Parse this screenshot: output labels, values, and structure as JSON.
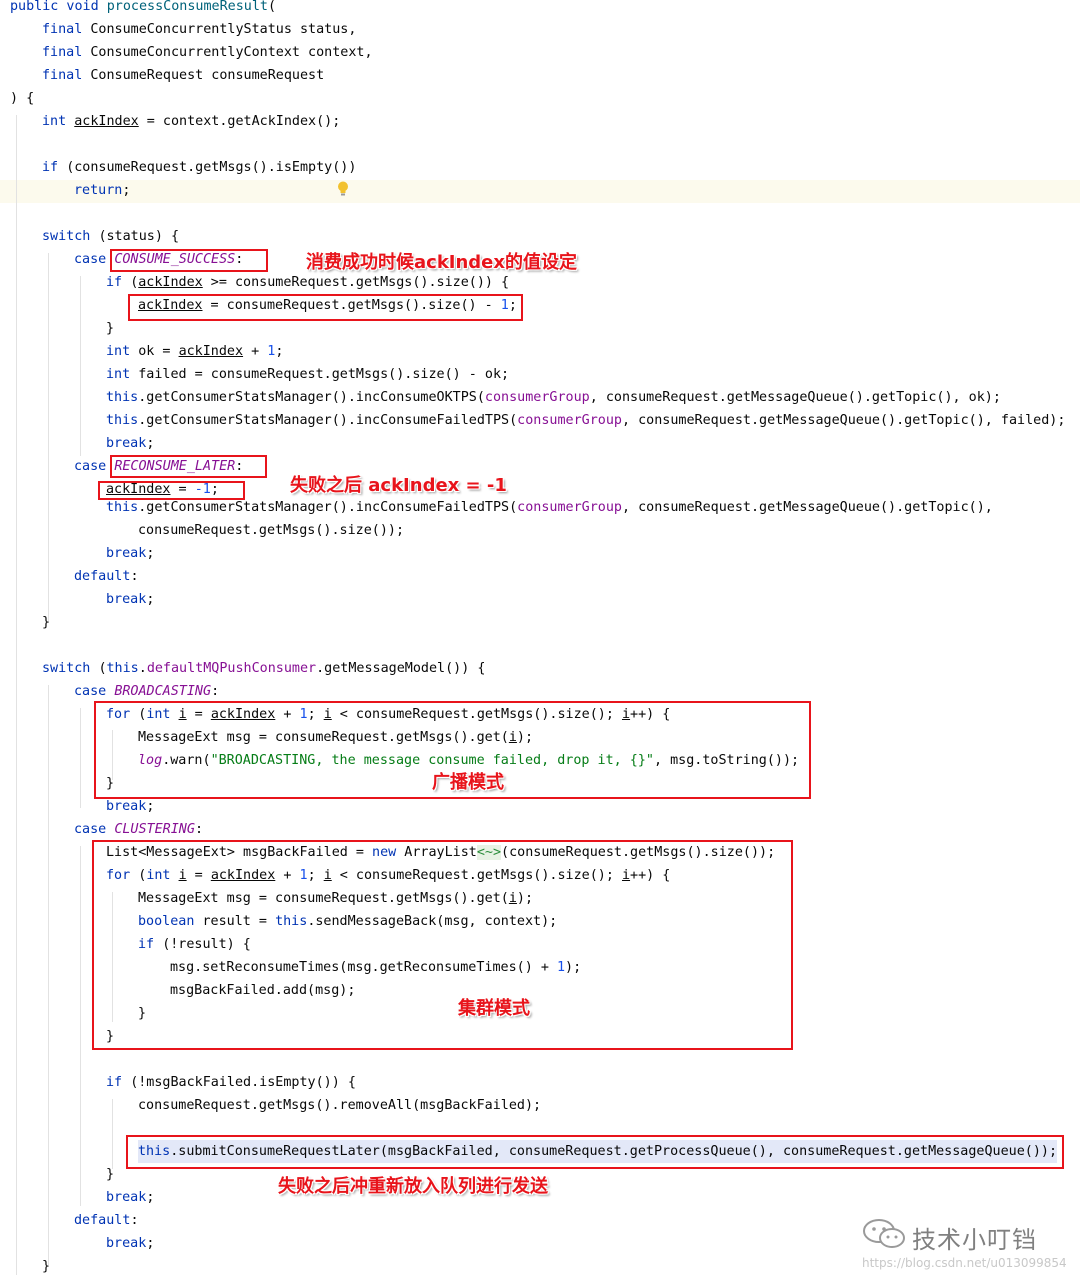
{
  "code": {
    "method_signature": [
      "public void ",
      "processConsumeResult",
      "("
    ],
    "param_status": [
      "final ",
      "ConsumeConcurrentlyStatus status,"
    ],
    "param_context": [
      "final ",
      "ConsumeConcurrentlyContext context,"
    ],
    "param_request": [
      "final ",
      "ConsumeRequest consumeRequest"
    ],
    "close_paren": ") {",
    "ack_decl": [
      "int ",
      "ackIndex",
      " = context.getAckIndex();"
    ],
    "if_empty": [
      "if ",
      "(consumeRequest.getMsgs().isEmpty())"
    ],
    "return_stmt": [
      "return",
      ";"
    ],
    "switch_status": [
      "switch ",
      "(status) {"
    ],
    "case_success": [
      "case ",
      "CONSUME_SUCCESS",
      ":"
    ],
    "if_ack": [
      "if ",
      "(",
      "ackIndex",
      " >= consumeRequest.getMsgs().size()) {"
    ],
    "ack_assign": [
      "ackIndex",
      " = consumeRequest.getMsgs().size() - ",
      "1",
      ";"
    ],
    "close_brace": "}",
    "int_ok": [
      "int ",
      "ok = ",
      "ackIndex",
      " + ",
      "1",
      ";"
    ],
    "int_failed": [
      "int ",
      "failed = consumeRequest.getMsgs().size() - ok;"
    ],
    "inc_ok": [
      "this",
      ".getConsumerStatsManager().incConsumeOKTPS(",
      "consumerGroup",
      ", consumeRequest.getMessageQueue().getTopic(), ok);"
    ],
    "inc_failed": [
      "this",
      ".getConsumerStatsManager().incConsumeFailedTPS(",
      "consumerGroup",
      ", consumeRequest.getMessageQueue().getTopic(), failed);"
    ],
    "break_stmt": [
      "break",
      ";"
    ],
    "case_later": [
      "case ",
      "RECONSUME_LATER",
      ":"
    ],
    "ack_minus": [
      "ackIndex",
      " = ",
      "-1",
      ";"
    ],
    "inc_failed2": [
      "this",
      ".getConsumerStatsManager().incConsumeFailedTPS(",
      "consumerGroup",
      ", consumeRequest.getMessageQueue().getTopic(),"
    ],
    "msgs_size": "consumeRequest.getMsgs().size());",
    "default_label": [
      "default",
      ":"
    ],
    "switch_model": [
      "switch ",
      "(",
      "this",
      ".",
      "defaultMQPushConsumer",
      ".getMessageModel()) {"
    ],
    "case_broadcasting": [
      "case ",
      "BROADCASTING",
      ":"
    ],
    "for_loop": [
      "for ",
      "(",
      "int ",
      "i",
      " = ",
      "ackIndex",
      " + ",
      "1",
      "; ",
      "i",
      " < consumeRequest.getMsgs().size(); ",
      "i",
      "++) {"
    ],
    "msg_ext": [
      "MessageExt msg = consumeRequest.getMsgs().get(",
      "i",
      ");"
    ],
    "log_warn": [
      "log",
      ".warn(",
      "\"BROADCASTING, the message consume failed, drop it, {}\"",
      ", msg.toString());"
    ],
    "case_clustering": [
      "case ",
      "CLUSTERING",
      ":"
    ],
    "list_decl": [
      "List<MessageExt> msgBackFailed = ",
      "new ",
      "ArrayList",
      "<~>",
      "(consumeRequest.getMsgs().size());"
    ],
    "boolean_result": [
      "boolean ",
      "result = ",
      "this",
      ".sendMessageBack(msg, context);"
    ],
    "if_not_result": [
      "if ",
      "(!result) {"
    ],
    "set_reconsume": [
      "msg.setReconsumeTimes(msg.getReconsumeTimes() + ",
      "1",
      ");"
    ],
    "add_failed": "msgBackFailed.add(msg);",
    "if_not_empty": [
      "if ",
      "(!msgBackFailed.isEmpty()) {"
    ],
    "remove_all": "consumeRequest.getMsgs().removeAll(msgBackFailed);",
    "submit_later": [
      "this",
      ".submitConsumeRequestLater(msgBackFailed, consumeRequest.getProcessQueue(), consumeRequest.getMessageQueue());"
    ]
  },
  "annotations": {
    "success_note": "消费成功时候ackIndex的值设定",
    "failure_note": "失败之后 ackIndex = -1",
    "broadcast_note": "广播模式",
    "cluster_note": "集群模式",
    "resend_note": "失败之后冲重新放入队列进行发送"
  },
  "watermark": {
    "icon": "wechat-icon",
    "account": "技术小叮铛",
    "url": "https://blog.csdn.net/u013099854"
  },
  "colors": {
    "keyword": "#0033b3",
    "field": "#871094",
    "number": "#1750eb",
    "string": "#067d17",
    "annotation_red": "#e8141b"
  }
}
